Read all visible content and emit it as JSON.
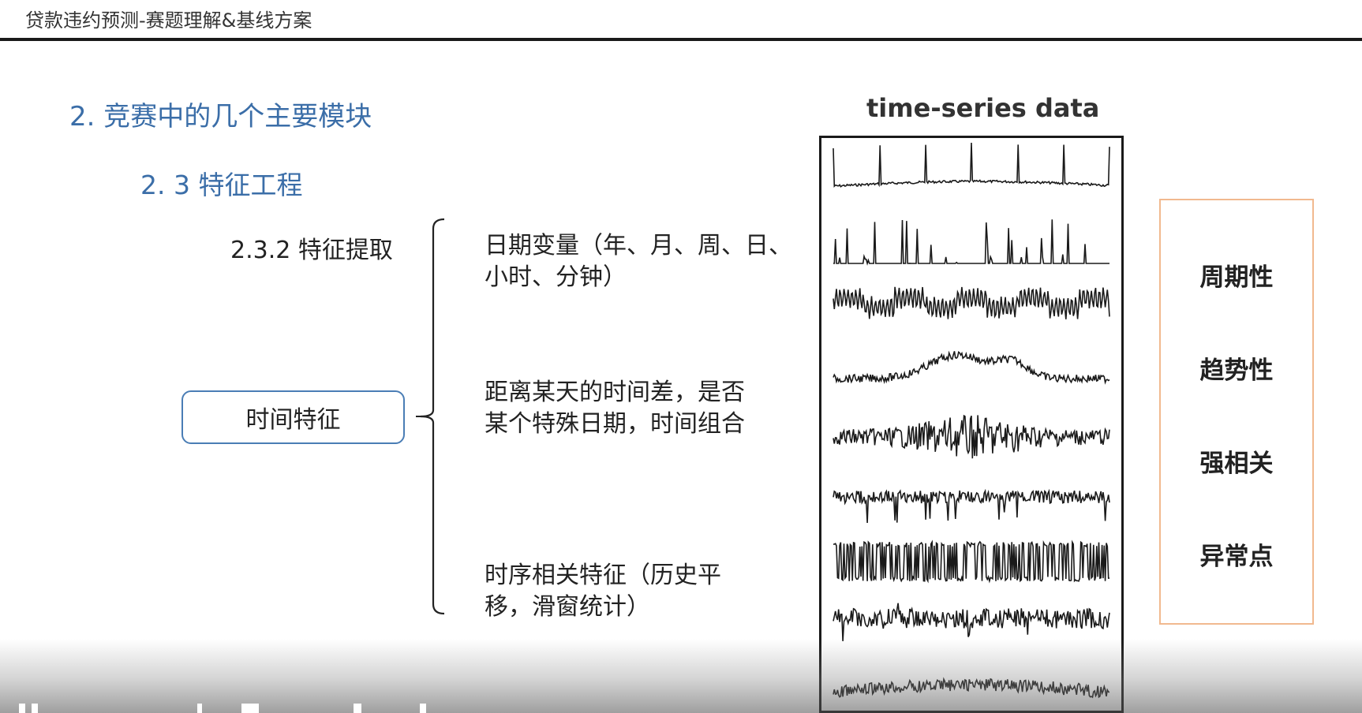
{
  "window": {
    "title": "贷款违约预测-赛题理解&基线方案"
  },
  "section": {
    "title": "2. 竞赛中的几个主要模块"
  },
  "subsection": {
    "title": "2. 3  特征工程"
  },
  "subsubsection": {
    "title": "2.3.2 特征提取"
  },
  "category": {
    "label": "时间特征"
  },
  "items": [
    {
      "line1": "日期变量（年、月、周、日、",
      "line2": "小时、分钟）"
    },
    {
      "line1": "距离某天的时间差，是否",
      "line2": "某个特殊日期，时间组合"
    },
    {
      "line1": "时序相关特征（历史平",
      "line2": "移，滑窗统计）"
    }
  ],
  "figure": {
    "caption": "time-series data",
    "series_count": 10
  },
  "properties": [
    "周期性",
    "趋势性",
    "强相关",
    "异常点"
  ],
  "colors": {
    "accent": "#3b6ea8",
    "box_border": "#4a7db5",
    "props_border": "#f1b98f"
  }
}
